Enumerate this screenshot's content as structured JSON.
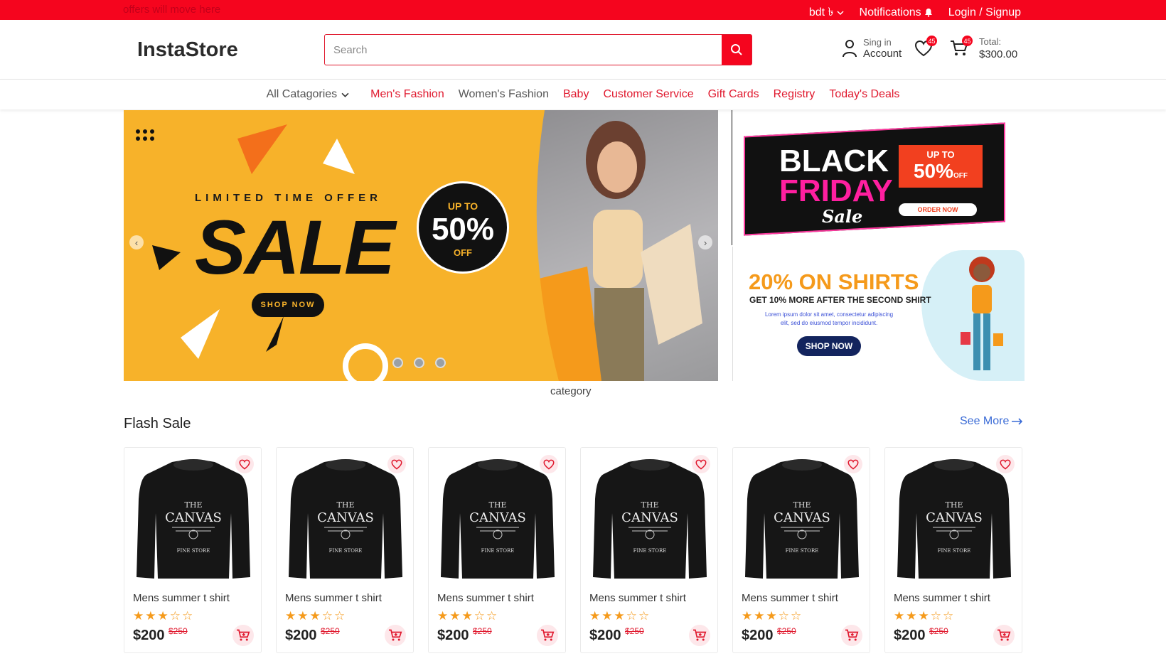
{
  "topbar": {
    "offers_text": "offers will move here",
    "currency": "bdt ৳",
    "notifications": "Notifications",
    "login": "Login / Signup"
  },
  "header": {
    "logo": "InstaStore",
    "search_placeholder": "Search",
    "account_line1": "Sing in",
    "account_line2": "Account",
    "wishlist_count": "45",
    "cart_count": "45",
    "total_label": "Total:",
    "total_value": "$300.00"
  },
  "nav": {
    "all_categories": "All Catagories",
    "items": [
      "Men's Fashion",
      "Women's Fashion",
      "Baby",
      "Customer Service",
      "Gift Cards",
      "Registry",
      "Today's Deals"
    ]
  },
  "hero": {
    "limited": "LIMITED TIME OFFER",
    "sale": "SALE",
    "shop_now": "SHOP NOW",
    "badge_up": "UP TO",
    "badge_pct": "50%",
    "badge_off": "OFF",
    "category_label": "category"
  },
  "side_banners": {
    "black_friday": {
      "black": "BLACK",
      "friday": "FRIDAY",
      "sale": "Sale",
      "up_to": "UP TO",
      "pct": "50%",
      "off": "OFF",
      "order_now": "ORDER NOW"
    },
    "shirts": {
      "headline": "20% ON SHIRTS",
      "sub": "GET 10% MORE AFTER THE SECOND SHIRT",
      "lorem": "Lorem ipsum dolor sit amet, consectetur adipiscing elit, sed do eiusmod tempor incididunt.",
      "shop_now": "SHOP NOW"
    }
  },
  "flash_sale": {
    "title": "Flash Sale",
    "see_more": "See More",
    "products": [
      {
        "name": "Mens summer t shirt",
        "price": "$200",
        "old_price": "$250",
        "rating": 3
      },
      {
        "name": "Mens summer t shirt",
        "price": "$200",
        "old_price": "$250",
        "rating": 3
      },
      {
        "name": "Mens summer t shirt",
        "price": "$200",
        "old_price": "$250",
        "rating": 3
      },
      {
        "name": "Mens summer t shirt",
        "price": "$200",
        "old_price": "$250",
        "rating": 3
      },
      {
        "name": "Mens summer t shirt",
        "price": "$200",
        "old_price": "$250",
        "rating": 3
      },
      {
        "name": "Mens summer t shirt",
        "price": "$200",
        "old_price": "$250",
        "rating": 3
      }
    ],
    "shirt_print": {
      "the": "THE",
      "canvas": "CANVAS",
      "store": "FINE STORE"
    }
  },
  "colors": {
    "brand_red": "#f5051e",
    "accent_orange": "#f59a1b",
    "link_blue": "#3a6bd6"
  },
  "icons": [
    "bell-icon",
    "user-icon",
    "heart-icon",
    "cart-icon",
    "search-icon",
    "chevron-down-icon",
    "arrow-right-icon",
    "star-icon"
  ]
}
